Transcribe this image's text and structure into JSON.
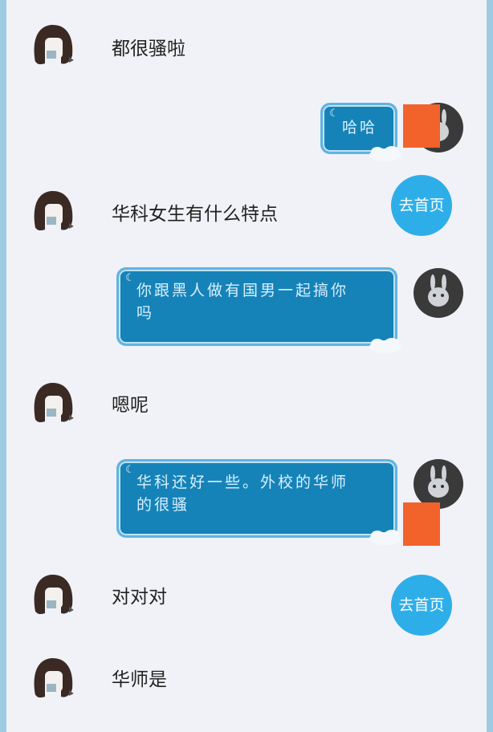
{
  "messages": {
    "m1": {
      "text": "都很骚啦"
    },
    "m2": {
      "text": "哈哈"
    },
    "m3": {
      "text": "华科女生有什么特点"
    },
    "m4": {
      "line1": "你跟黑人做有国男一起搞你",
      "line2": "吗"
    },
    "m5": {
      "text": "嗯呢"
    },
    "m6": {
      "line1": "华科还好一些。外校的华师",
      "line2": "的很骚"
    },
    "m7": {
      "text": "对对对"
    },
    "m8": {
      "text": "华师是"
    }
  },
  "buttons": {
    "home_label": "去首页"
  },
  "colors": {
    "background": "#f1f2f7",
    "bubble": "#1683b8",
    "bubble_border": "#5fb4e2",
    "home_button": "#2eaee8",
    "badge": "#f2622b",
    "frame": "#9fcbe1"
  }
}
